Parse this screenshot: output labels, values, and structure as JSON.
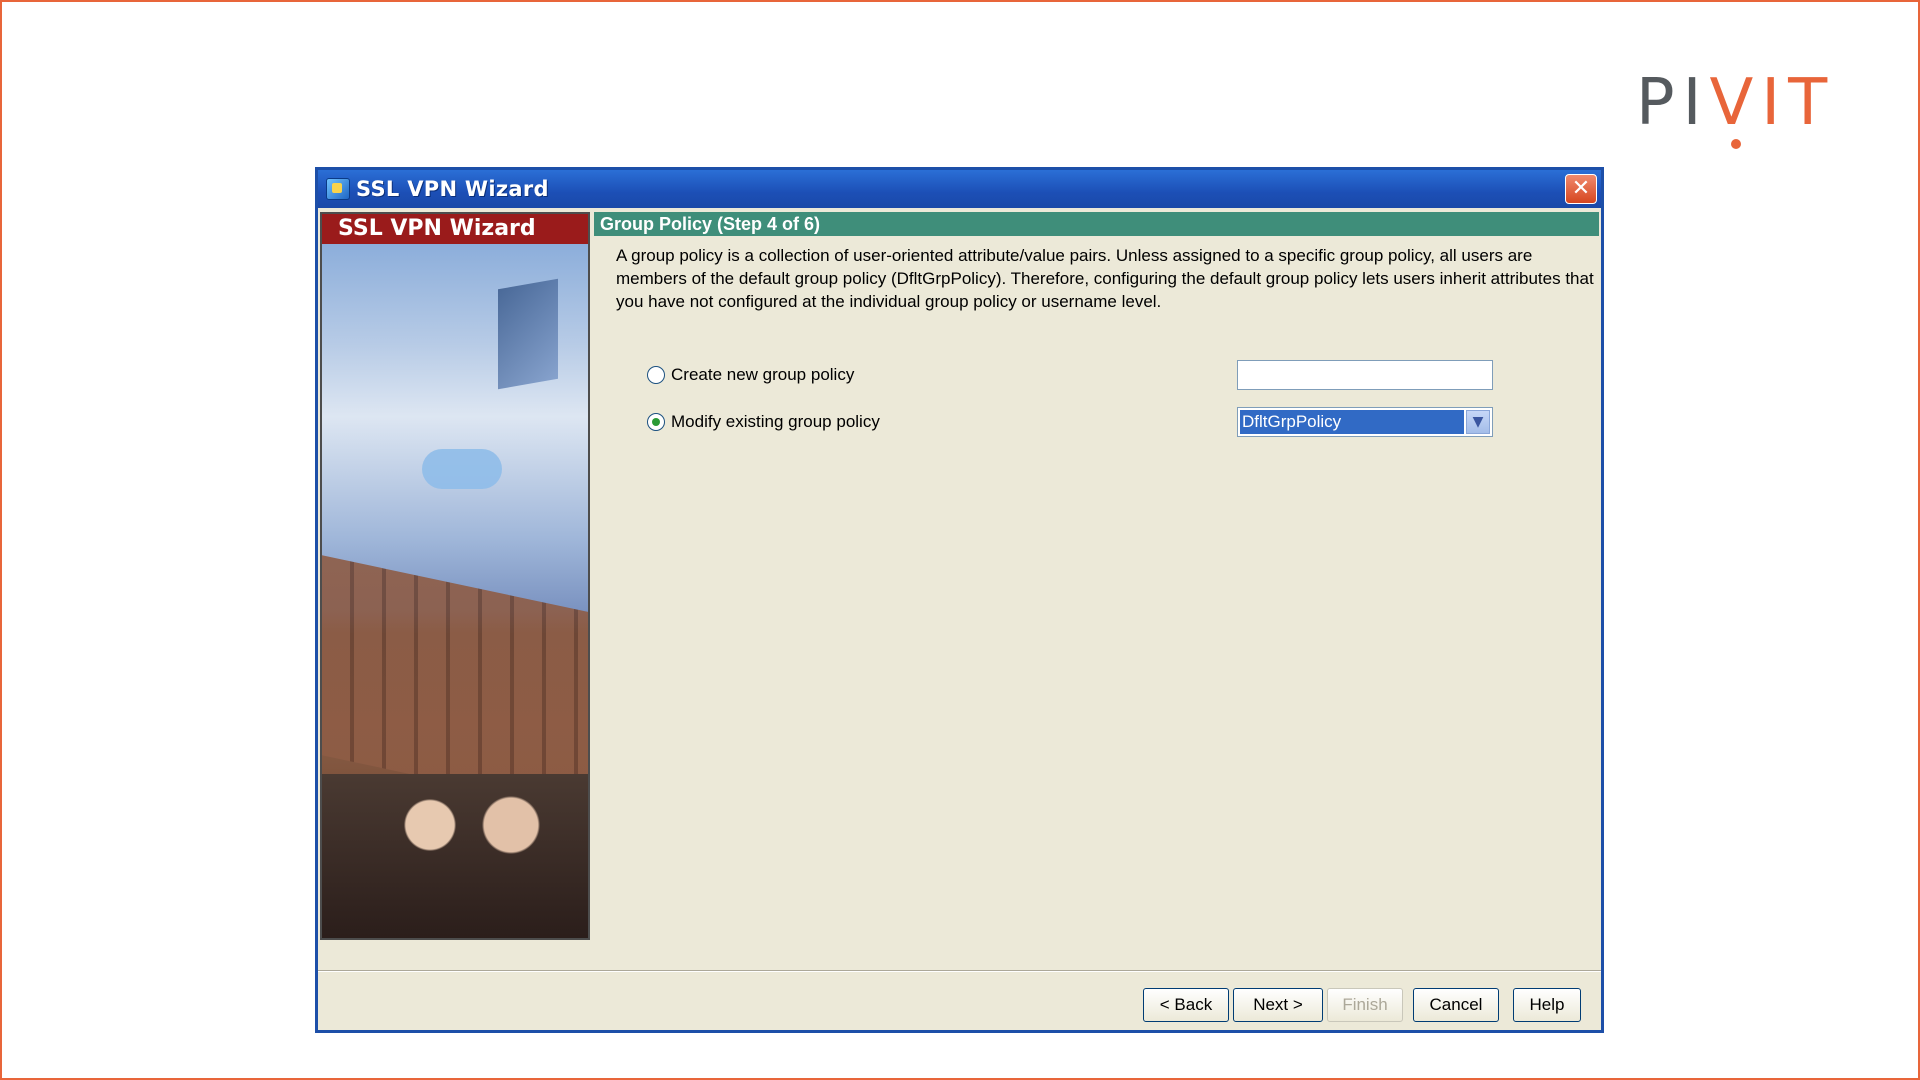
{
  "brand": {
    "logo_left": "PI",
    "logo_right": "VIT"
  },
  "window": {
    "title": "SSL VPN Wizard",
    "close_label": "✕"
  },
  "side_panel": {
    "banner": "SSL VPN Wizard"
  },
  "step": {
    "header": "Group Policy  (Step 4 of 6)",
    "description": "A group policy is a collection of user-oriented attribute/value pairs. Unless assigned to a specific group policy, all users are members of the default group policy (DfltGrpPolicy). Therefore, configuring the default group policy lets users inherit attributes that you have not configured at the individual group policy or username level."
  },
  "options": {
    "create_label": "Create new group policy",
    "create_value": "",
    "modify_label": "Modify existing group policy",
    "modify_value": "DfltGrpPolicy",
    "selected": "modify"
  },
  "buttons": {
    "back": "< Back",
    "next": "Next >",
    "finish": "Finish",
    "cancel": "Cancel",
    "help": "Help"
  },
  "colors": {
    "accent_orange": "#e8653a",
    "title_blue": "#1c4fb6",
    "header_teal": "#3f8e7a",
    "banner_red": "#9a1b1b"
  }
}
